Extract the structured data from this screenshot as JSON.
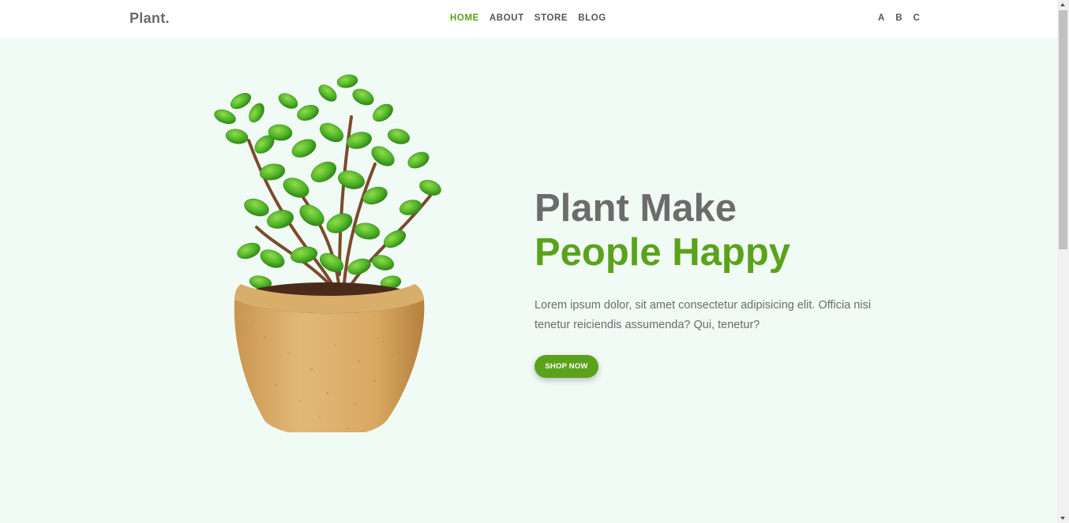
{
  "header": {
    "logo": "Plant.",
    "nav": [
      {
        "label": "HOME",
        "active": true
      },
      {
        "label": "ABOUT",
        "active": false
      },
      {
        "label": "STORE",
        "active": false
      },
      {
        "label": "BLOG",
        "active": false
      }
    ],
    "icons": [
      "A",
      "B",
      "C"
    ]
  },
  "hero": {
    "headline_line1": "Plant Make",
    "headline_line2": "People Happy",
    "description": "Lorem ipsum dolor, sit amet consectetur adipisicing elit. Officia nisi tenetur reiciendis assumenda? Qui, tenetur?",
    "button_label": "SHOP NOW",
    "image_icon": "potted-plant-image"
  },
  "colors": {
    "accent": "#5ba21c",
    "background": "#f1fbf5",
    "text_gray": "#6b6b6b",
    "pot": "#d9ad6a"
  }
}
